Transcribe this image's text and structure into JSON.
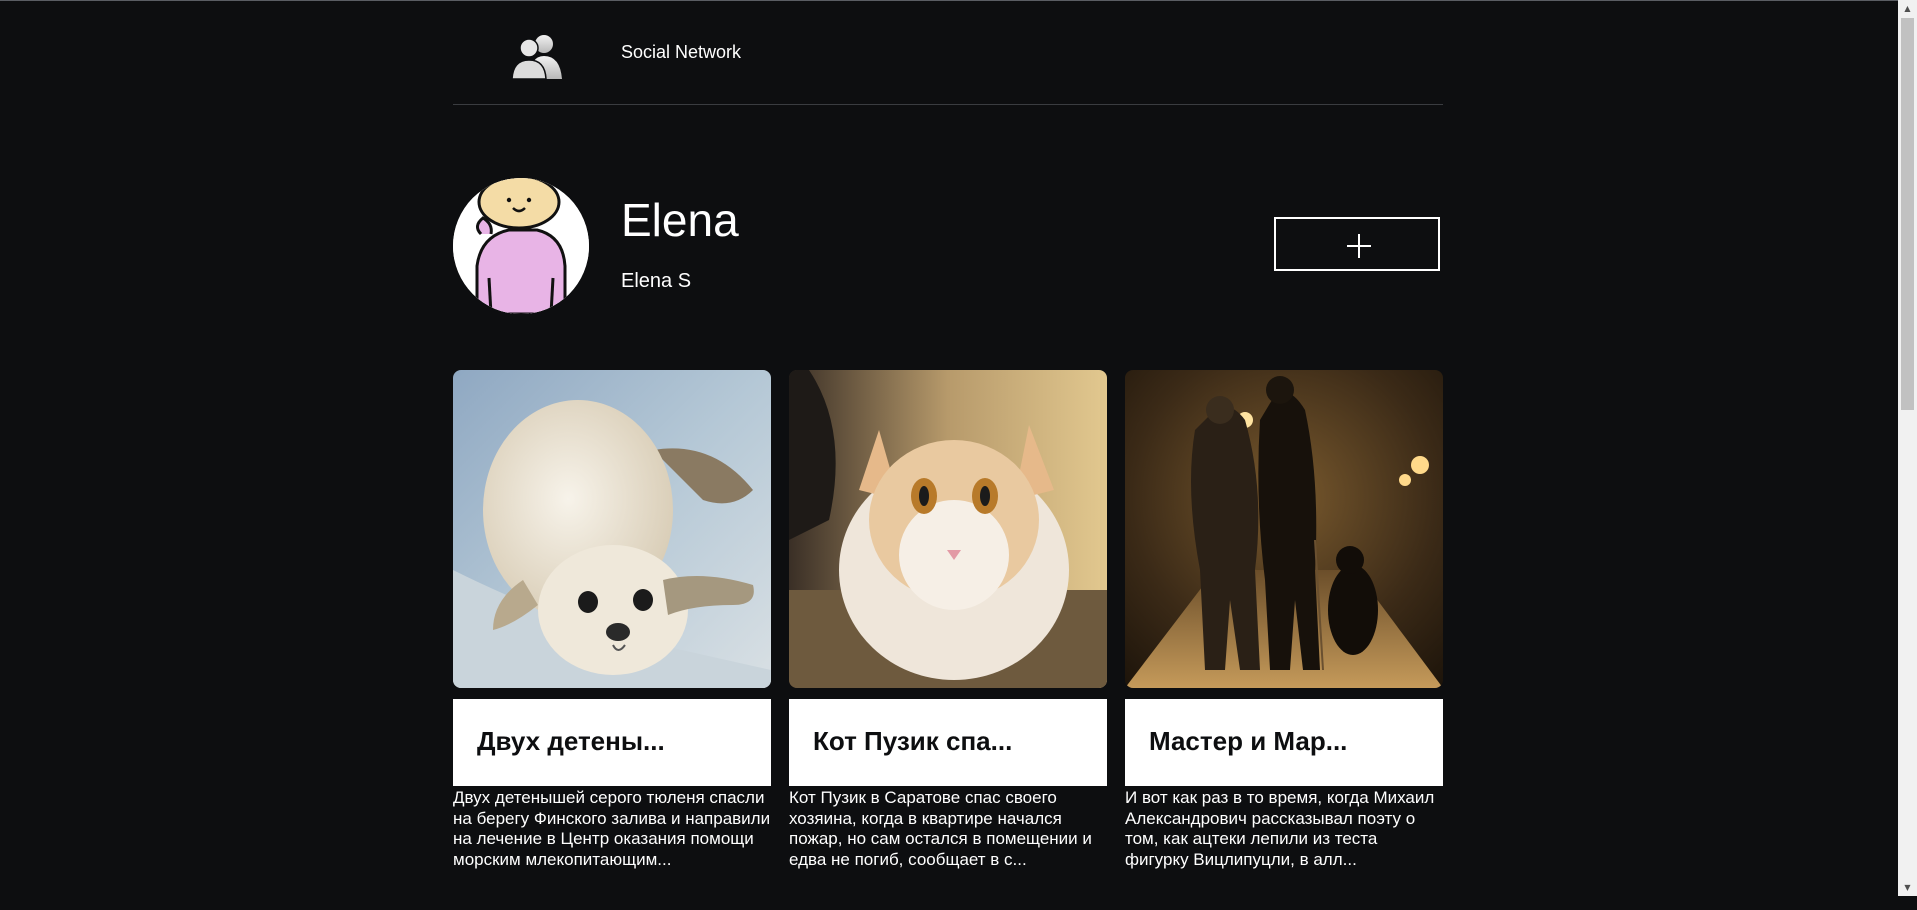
{
  "header": {
    "brand": "Social Network",
    "logo_icon": "users-icon"
  },
  "profile": {
    "name": "Elena",
    "username": "Elena S",
    "add_button_icon": "plus-icon"
  },
  "posts": [
    {
      "image": "seal-pup-photo",
      "title": "Двух детены...",
      "description": "Двух детенышей серого тюленя спасли на берегу Финского залива и направили на лечение в Центр оказания помощи морским млекопитающим..."
    },
    {
      "image": "cat-photo",
      "title": "Кот Пузик спа...",
      "description": "Кот Пузик в Саратове спас своего хозяина, когда в квартире начался пожар, но сам остался в помещении и едва не погиб, сообщает в с..."
    },
    {
      "image": "night-street-photo",
      "title": "Мастер и Мар...",
      "description": "И вот как раз в то время, когда Михаил Александрович рассказывал поэту о том, как ацтеки лепили из теста фигурку Вицлипуцли, в алл..."
    }
  ],
  "colors": {
    "background": "#0d0e10",
    "text": "#ffffff",
    "card_title_bg": "#ffffff"
  }
}
